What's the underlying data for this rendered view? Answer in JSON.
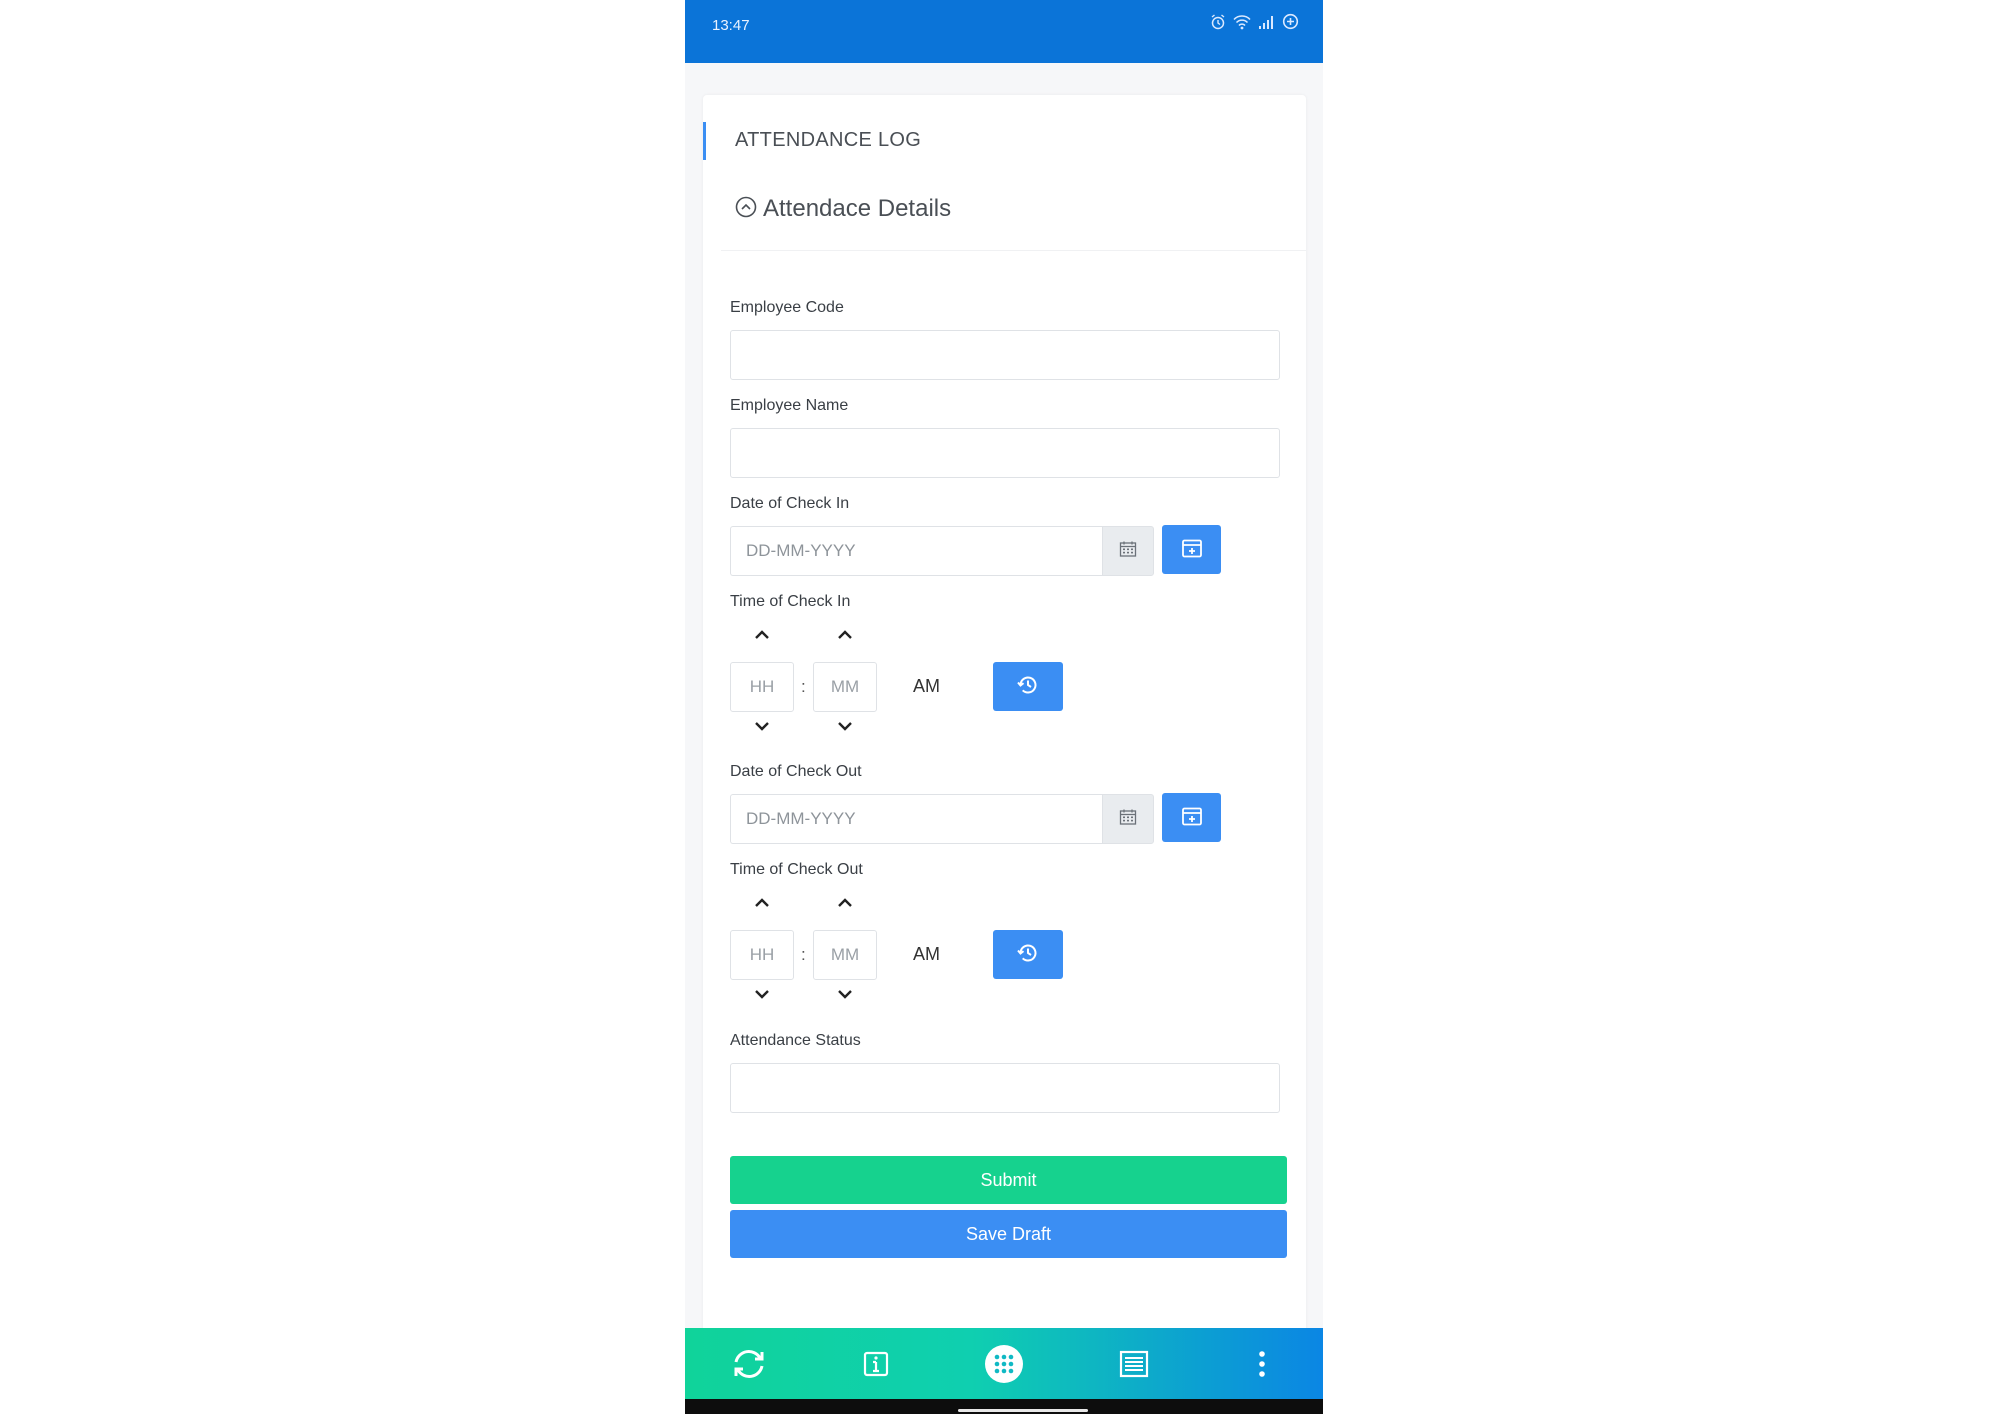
{
  "status_bar": {
    "time": "13:47",
    "icons": [
      "alarm-icon",
      "wifi-icon",
      "signal-icon",
      "data-saver-icon"
    ]
  },
  "page": {
    "title": "ATTENDANCE LOG",
    "section_title": "Attendace Details"
  },
  "form": {
    "employee_code": {
      "label": "Employee Code",
      "value": ""
    },
    "employee_name": {
      "label": "Employee Name",
      "value": ""
    },
    "checkin_date": {
      "label": "Date of Check In",
      "placeholder": "DD-MM-YYYY"
    },
    "checkin_time": {
      "label": "Time of Check In",
      "hour_placeholder": "HH",
      "minute_placeholder": "MM",
      "separator": ":",
      "period": "AM"
    },
    "checkout_date": {
      "label": "Date of Check Out",
      "placeholder": "DD-MM-YYYY"
    },
    "checkout_time": {
      "label": "Time of Check Out",
      "hour_placeholder": "HH",
      "minute_placeholder": "MM",
      "separator": ":",
      "period": "AM"
    },
    "attendance_status": {
      "label": "Attendance Status",
      "value": ""
    }
  },
  "actions": {
    "submit_label": "Submit",
    "save_draft_label": "Save Draft"
  },
  "bottom_nav": {
    "items": [
      "sync-icon",
      "info-icon",
      "apps-grid-icon",
      "list-icon",
      "more-vertical-icon"
    ]
  },
  "colors": {
    "status_bar": "#0b74d8",
    "primary_blue": "#3b8ef3",
    "submit_green": "#16d28e",
    "nav_gradient_start": "#10d39a",
    "nav_gradient_end": "#0b86e4"
  }
}
